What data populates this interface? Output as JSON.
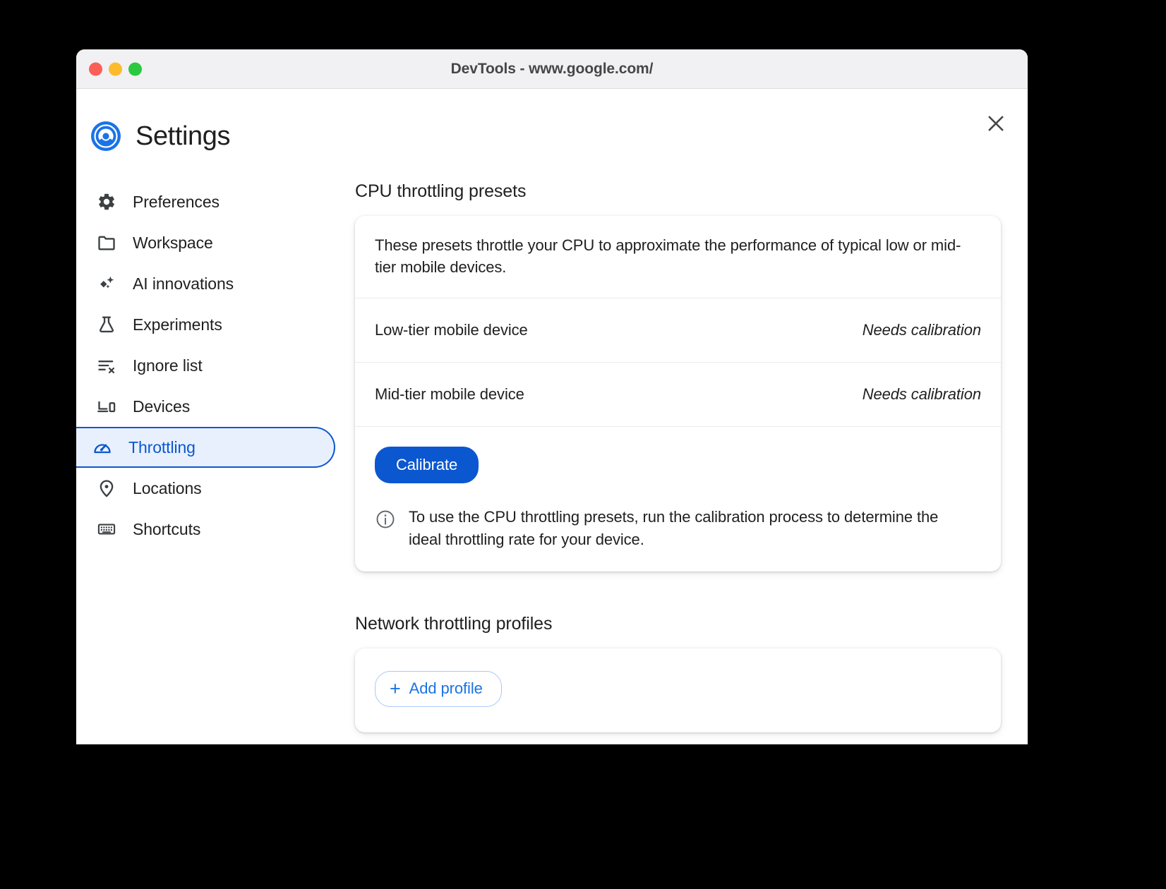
{
  "window": {
    "title": "DevTools - www.google.com/",
    "traffic_lights": [
      "close",
      "minimize",
      "maximize"
    ]
  },
  "header": {
    "title": "Settings",
    "logo": "chrome-devtools-logo",
    "close_icon": "close-icon"
  },
  "sidebar": {
    "items": [
      {
        "label": "Preferences",
        "icon": "gear-icon",
        "selected": false
      },
      {
        "label": "Workspace",
        "icon": "folder-icon",
        "selected": false
      },
      {
        "label": "AI innovations",
        "icon": "sparkle-icon",
        "selected": false
      },
      {
        "label": "Experiments",
        "icon": "flask-icon",
        "selected": false
      },
      {
        "label": "Ignore list",
        "icon": "list-x-icon",
        "selected": false
      },
      {
        "label": "Devices",
        "icon": "devices-icon",
        "selected": false
      },
      {
        "label": "Throttling",
        "icon": "speedometer-icon",
        "selected": true
      },
      {
        "label": "Locations",
        "icon": "location-pin-icon",
        "selected": false
      },
      {
        "label": "Shortcuts",
        "icon": "keyboard-icon",
        "selected": false
      }
    ]
  },
  "main": {
    "cpu_section": {
      "title": "CPU throttling presets",
      "description": "These presets throttle your CPU to approximate the performance of typical low or mid-tier mobile devices.",
      "presets": [
        {
          "name": "Low-tier mobile device",
          "status": "Needs calibration"
        },
        {
          "name": "Mid-tier mobile device",
          "status": "Needs calibration"
        }
      ],
      "calibrate_label": "Calibrate",
      "info_icon": "info-circle-icon",
      "info_text": "To use the CPU throttling presets, run the calibration process to determine the ideal throttling rate for your device."
    },
    "network_section": {
      "title": "Network throttling profiles",
      "add_profile_label": "Add profile",
      "add_icon": "plus-icon"
    }
  },
  "colors": {
    "accent_blue": "#0b57d0",
    "link_blue": "#1a73e8",
    "selected_bg": "#e8f0fe",
    "text": "#1f1f1f",
    "titlebar_bg": "#f1f1f3"
  }
}
